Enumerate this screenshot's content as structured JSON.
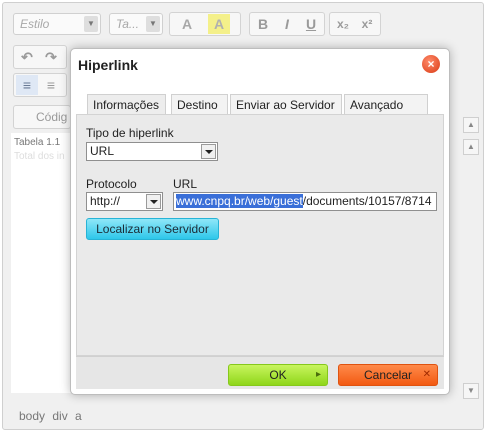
{
  "editor": {
    "style_combo": "Estilo",
    "size_combo": "Ta...",
    "status_path": "body div a",
    "source_label": "Códig",
    "table_caption": "Tabela 1.1",
    "table_cell": "Total dos in"
  },
  "dialog": {
    "title": "Hiperlink",
    "close_glyph": "×",
    "tabs": [
      "Informações",
      "Destino",
      "Enviar ao Servidor",
      "Avançado"
    ],
    "link_type_label": "Tipo de hiperlink",
    "link_type_value": "URL",
    "protocol_label": "Protocolo",
    "protocol_value": "http://",
    "url_label": "URL",
    "url_selected": "www.cnpq.br/web/guest",
    "url_rest": "/documents/10157/8714",
    "browse_button": "Localizar no Servidor",
    "ok_button": "OK",
    "ok_icon": "▸",
    "cancel_button": "Cancelar",
    "cancel_icon": "✕"
  },
  "colors": {
    "ok": "#a6e22e",
    "cancel": "#f26522",
    "browse": "#45d0f0",
    "selection": "#3a6fd8"
  }
}
